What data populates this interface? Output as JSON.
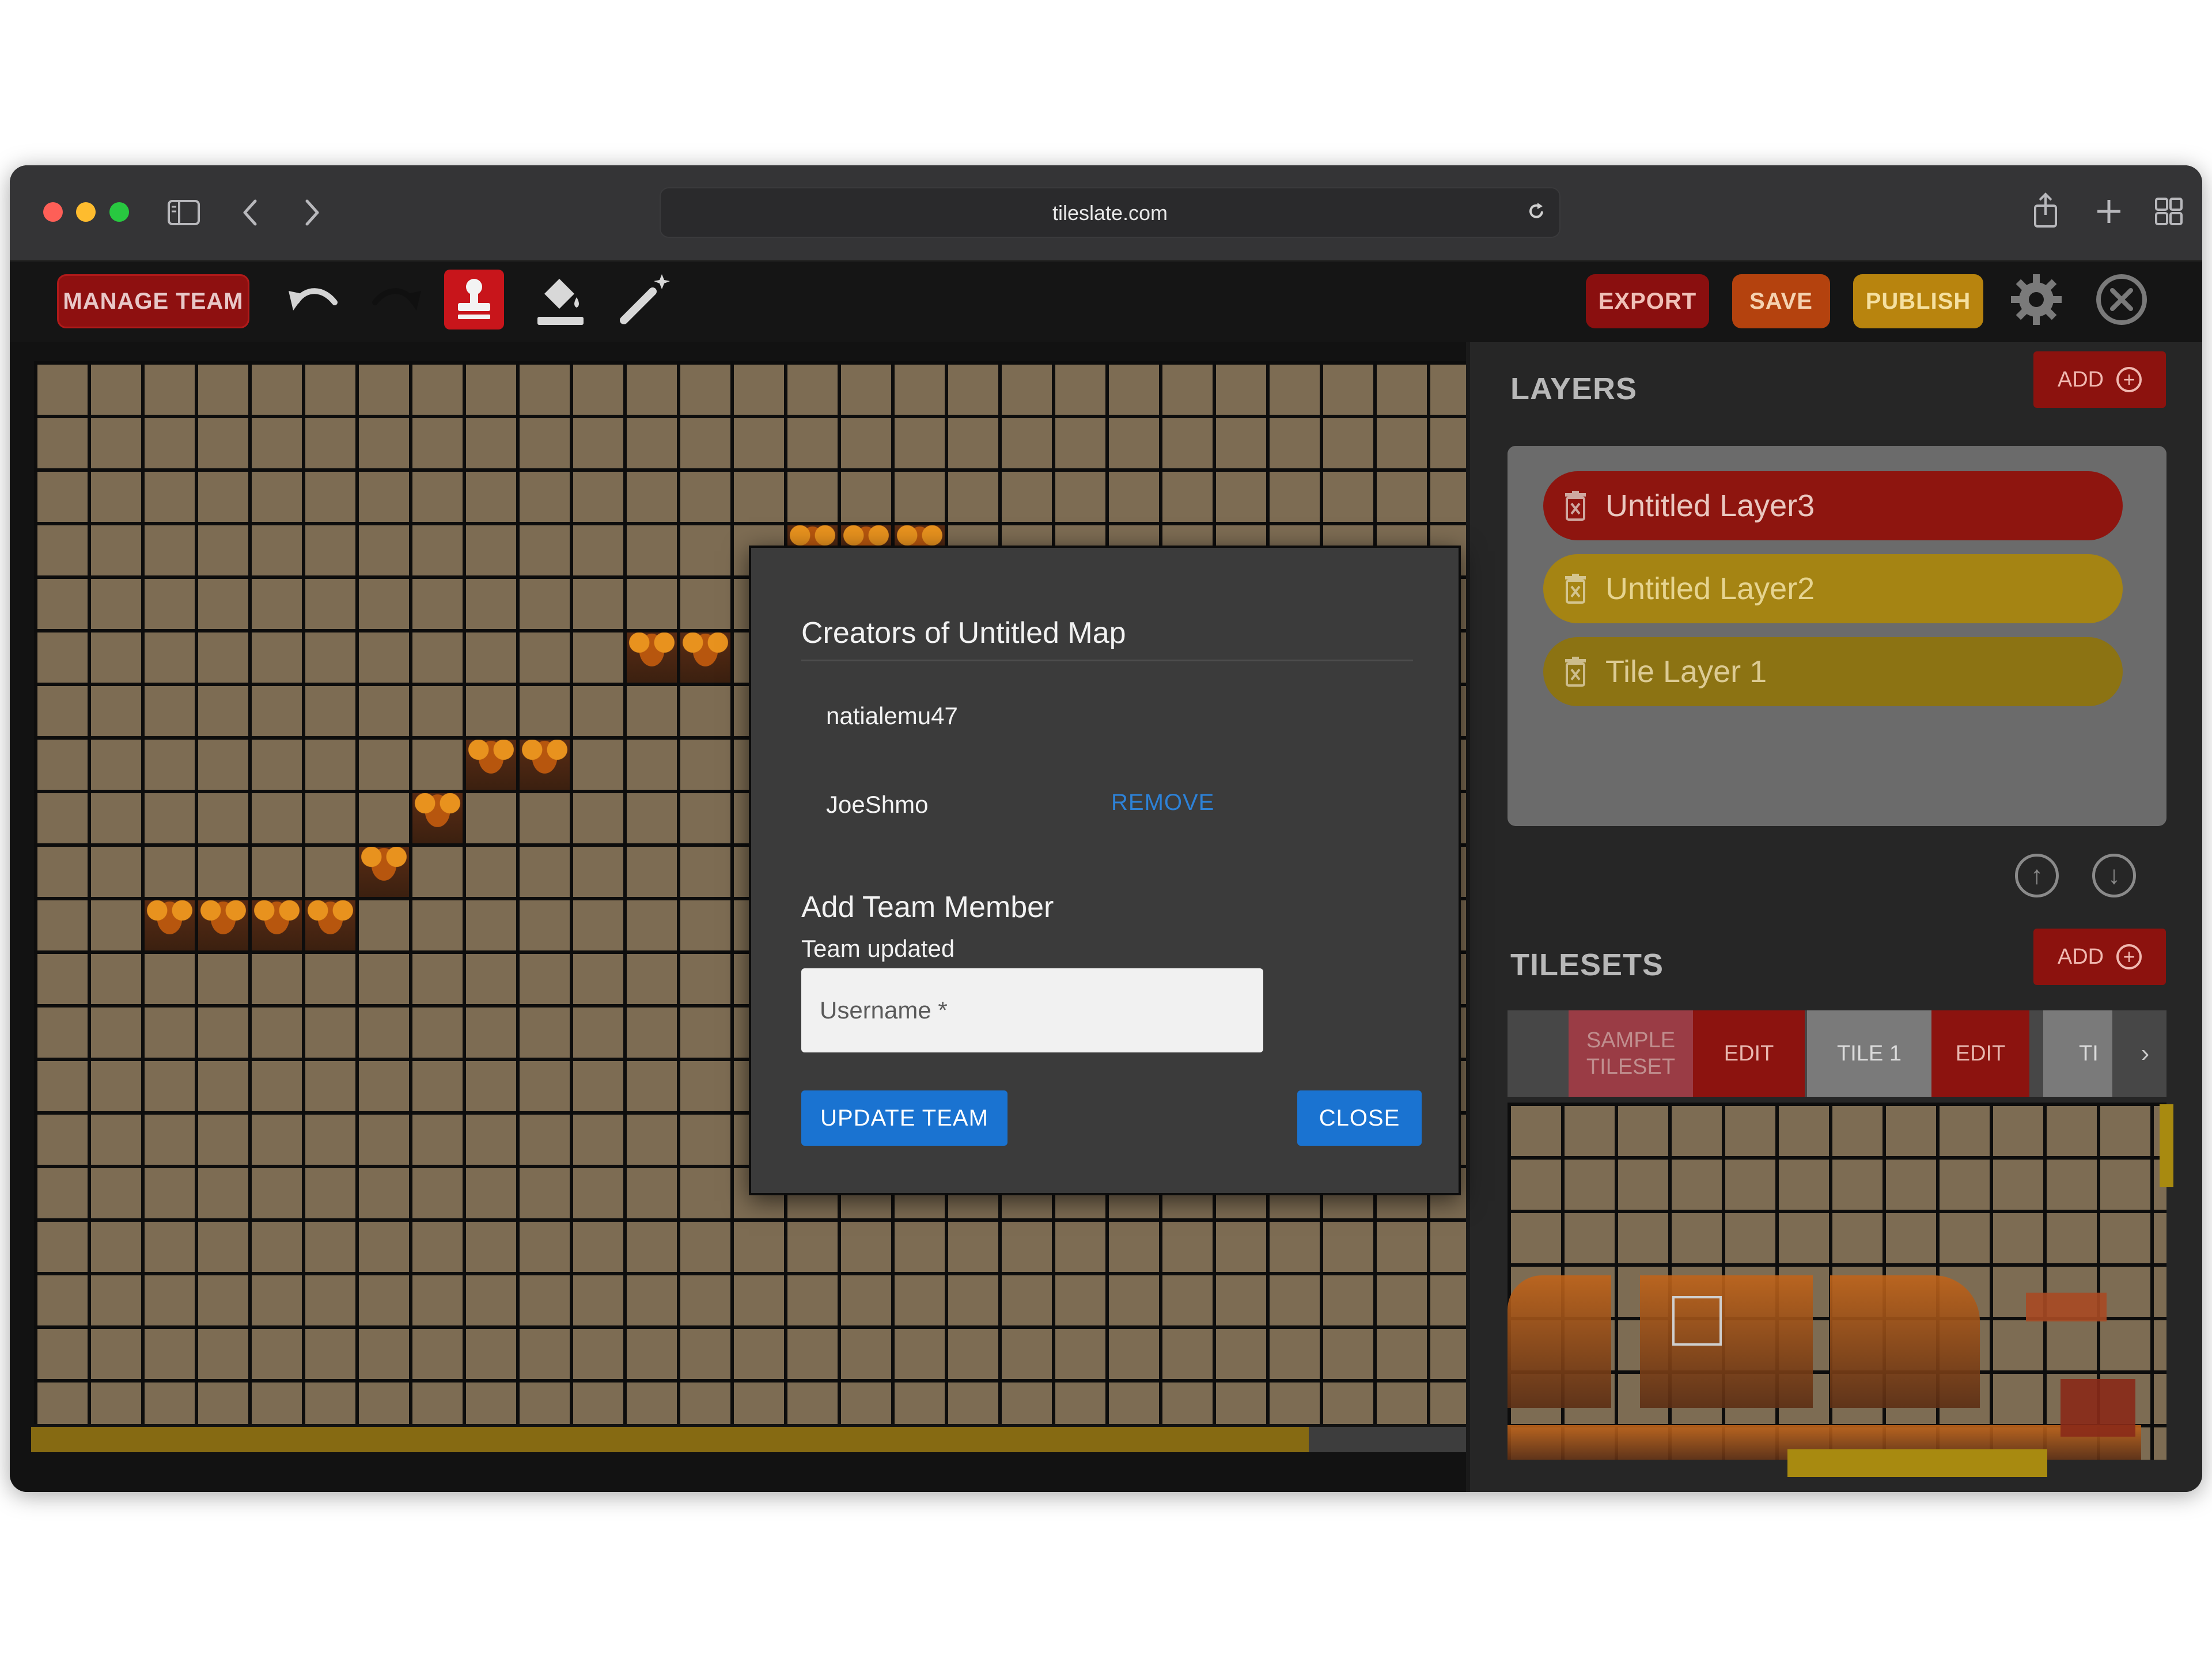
{
  "browser": {
    "url": "tileslate.com",
    "icons": [
      "sidebar-icon",
      "back-icon",
      "forward-icon",
      "reload-icon",
      "share-icon",
      "new-tab-icon",
      "tab-overview-icon"
    ]
  },
  "toolbar": {
    "manage_team_label": "MANAGE TEAM",
    "export_label": "EXPORT",
    "save_label": "SAVE",
    "publish_label": "PUBLISH",
    "tools": [
      "undo-icon",
      "redo-icon",
      "stamp-icon",
      "fill-bucket-icon",
      "magic-wand-icon",
      "settings-icon",
      "close-icon"
    ]
  },
  "layers": {
    "title": "LAYERS",
    "add_label": "ADD",
    "items": [
      {
        "label": "Untitled Layer3",
        "color": "#8e150f"
      },
      {
        "label": "Untitled Layer2",
        "color": "#a58413"
      },
      {
        "label": "Tile Layer 1",
        "color": "#8c7313"
      }
    ]
  },
  "tilesets": {
    "title": "TILESETS",
    "add_label": "ADD",
    "tabs": [
      {
        "label": "SAMPLE TILESET",
        "edit_label": "EDIT"
      },
      {
        "label": "TILE 1",
        "edit_label": "EDIT"
      },
      {
        "label": "TI",
        "edit_label": ""
      }
    ]
  },
  "dialog": {
    "title": "Creators of Untitled Map",
    "members": [
      {
        "name": "natialemu47",
        "action": ""
      },
      {
        "name": "JoeShmo",
        "action": "REMOVE"
      }
    ],
    "add_title": "Add Team Member",
    "status": "Team updated",
    "username_placeholder": "Username *",
    "username_value": "",
    "update_label": "UPDATE TEAM",
    "close_label": "CLOSE"
  },
  "colors": {
    "accent_blue": "#1a73d1",
    "manage_red": "#8e1010",
    "save_orange": "#b4420e",
    "publish_gold": "#b8840e",
    "map_tile": "#7d6c53"
  }
}
